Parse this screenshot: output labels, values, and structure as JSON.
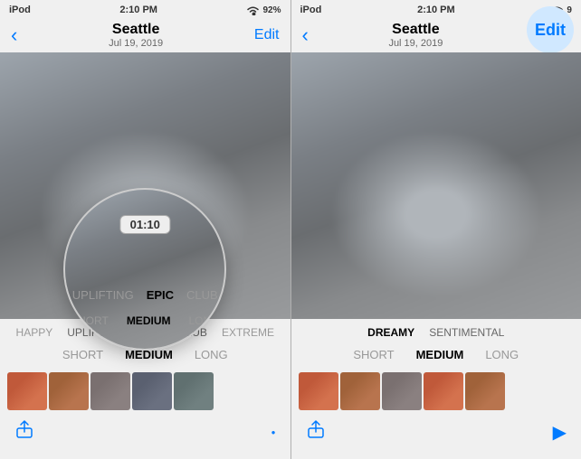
{
  "left_panel": {
    "device_name": "iPod",
    "time": "2:10 PM",
    "wifi": "wifi",
    "battery": "92%",
    "title": "Seattle",
    "subtitle": "Jul 19, 2019",
    "back_icon": "‹",
    "edit_label": "Edit",
    "time_badge": "01:10",
    "filters": [
      {
        "label": "HAPPY",
        "state": "dim"
      },
      {
        "label": "UPLIFTING",
        "state": "dim"
      },
      {
        "label": "EPIC",
        "state": "active"
      },
      {
        "label": "CLUB",
        "state": "semi"
      },
      {
        "label": "EXTREME",
        "state": "dim"
      }
    ],
    "durations": [
      {
        "label": "SHORT",
        "state": "normal"
      },
      {
        "label": "MEDIUM",
        "state": "active"
      },
      {
        "label": "LONG",
        "state": "normal"
      }
    ],
    "share_icon": "⬆",
    "play_icon": "▶"
  },
  "right_panel": {
    "device_name": "iPod",
    "time": "2:10 PM",
    "wifi": "wifi",
    "battery": "9",
    "title": "Seattle",
    "subtitle": "Jul 19, 2019",
    "back_icon": "‹",
    "edit_label": "Edit",
    "filters": [
      {
        "label": "DREAMY",
        "state": "normal"
      },
      {
        "label": "SENTIMENTAL",
        "state": "dim"
      }
    ],
    "durations": [
      {
        "label": "SHORT",
        "state": "normal"
      },
      {
        "label": "MEDIUM",
        "state": "active"
      },
      {
        "label": "LONG",
        "state": "normal"
      }
    ],
    "share_icon": "⬆",
    "play_icon": "▶"
  }
}
